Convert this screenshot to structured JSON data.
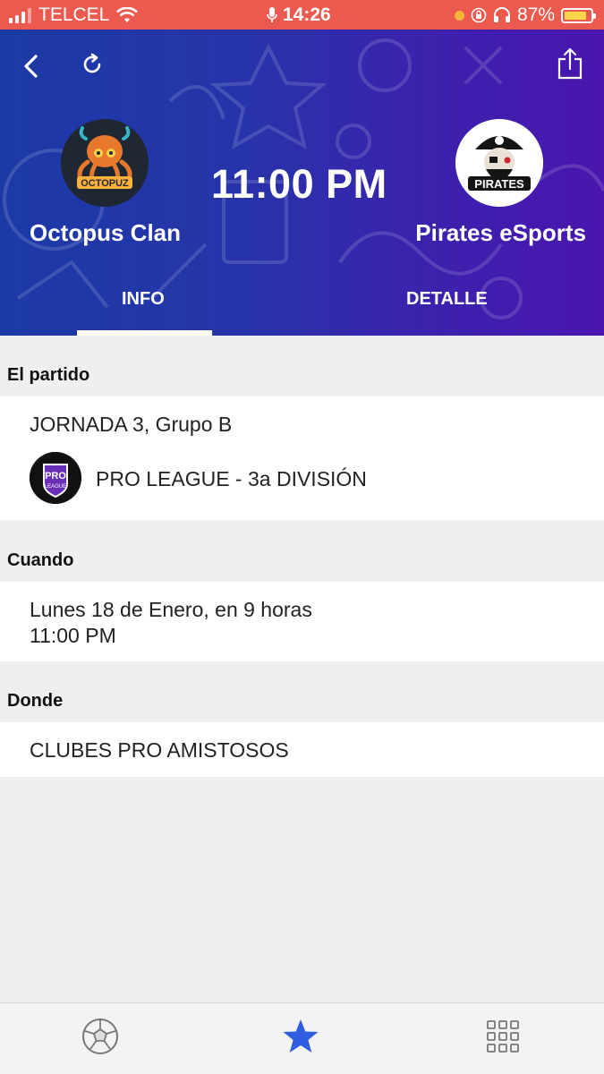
{
  "status_bar": {
    "carrier": "TELCEL",
    "time": "14:26",
    "battery": "87%",
    "battery_level": 0.87,
    "bar_color": "#ec5a4f"
  },
  "header": {
    "actions": [
      "back-icon",
      "reload-icon",
      "share-icon"
    ],
    "home_team": {
      "name": "Octopus Clan",
      "logo_icon": "octopus-logo"
    },
    "away_team": {
      "name": "Pirates eSports",
      "logo_icon": "pirate-logo"
    },
    "match_time": "11:00 PM",
    "tabs": [
      {
        "label": "INFO",
        "active": true
      },
      {
        "label": "DETALLE",
        "active": false
      }
    ],
    "gradient": [
      "#1c3aa6",
      "#4a16ae"
    ]
  },
  "sections": {
    "partido": {
      "title": "El partido",
      "round": "JORNADA 3, Grupo B",
      "league": "PRO LEAGUE - 3a DIVISIÓN",
      "league_logo_text": [
        "PRO",
        "LEAGUE"
      ]
    },
    "cuando": {
      "title": "Cuando",
      "date": "Lunes 18 de Enero, en 9 horas",
      "time": "11:00 PM"
    },
    "donde": {
      "title": "Donde",
      "venue": "CLUBES PRO AMISTOSOS"
    }
  },
  "bottom_nav": {
    "items": [
      "soccer-ball-icon",
      "star-icon",
      "grid-icon"
    ],
    "active": "star-icon",
    "active_color": "#2f5fe0"
  }
}
